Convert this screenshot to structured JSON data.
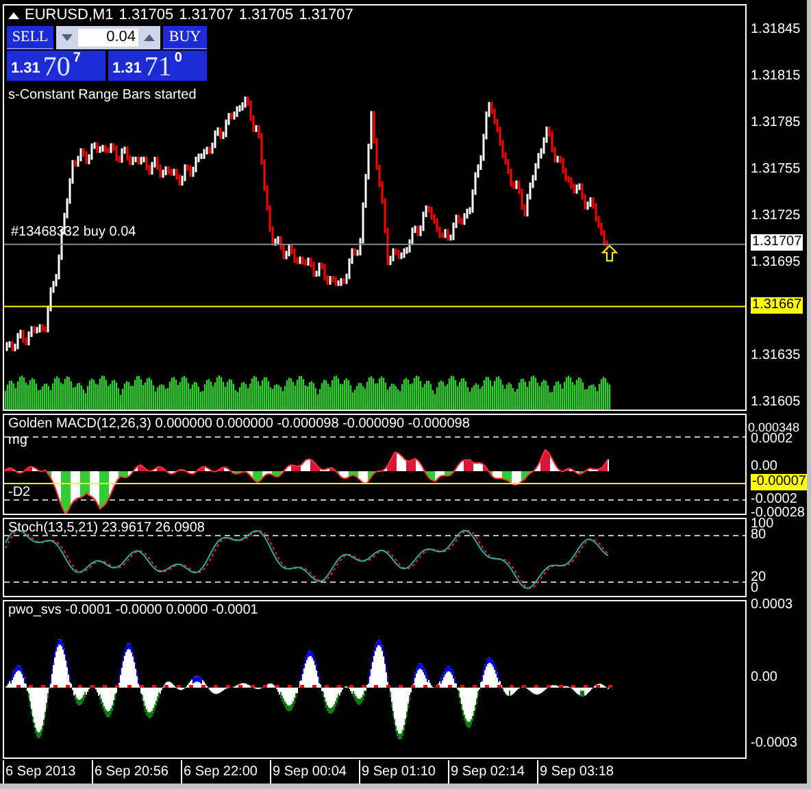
{
  "symbol_header": {
    "title": "EURUSD,M1",
    "quotes": [
      "1.31705",
      "1.31707",
      "1.31705",
      "1.31707"
    ]
  },
  "trade_panel": {
    "sell_label": "SELL",
    "buy_label": "BUY",
    "lot": "0.04",
    "sell_price": {
      "prefix": "1.31",
      "big": "70",
      "sup": "7"
    },
    "buy_price": {
      "prefix": "1.31",
      "big": "71",
      "sup": "0"
    }
  },
  "main_chart": {
    "message": "s-Constant Range Bars started",
    "order_label": "#13468332 buy 0.04",
    "price_axis": [
      "1.31845",
      "1.31815",
      "1.31785",
      "1.31755",
      "1.31725",
      "1.31695",
      "1.31635",
      "1.31605"
    ],
    "current_price": "1.31707",
    "line_price": "1.31667"
  },
  "macd": {
    "label": "Golden MACD(12,26,3) 0.000000 0.000000 -0.000098 -0.000090 -0.000098",
    "level_labels": [
      "mg",
      "-D2"
    ],
    "axis": [
      "0.000348",
      "0.0002",
      "0.00",
      "-0.0002",
      "-0.00028"
    ],
    "current_value": "-0.00007"
  },
  "stoch": {
    "label": "Stoch(13,5,21) 23.9617 26.0908",
    "axis": [
      "100",
      "80",
      "20",
      "0"
    ]
  },
  "pwo": {
    "label": "pwo_svs -0.0001 -0.0000 0.0000 -0.0001",
    "axis": [
      "0.0003",
      "0.00",
      "-0.0003"
    ]
  },
  "time_axis": [
    "6 Sep 2013",
    "6 Sep 20:56",
    "6 Sep 22:00",
    "9 Sep 00:04",
    "9 Sep 01:10",
    "9 Sep 02:14",
    "9 Sep 03:18"
  ]
}
